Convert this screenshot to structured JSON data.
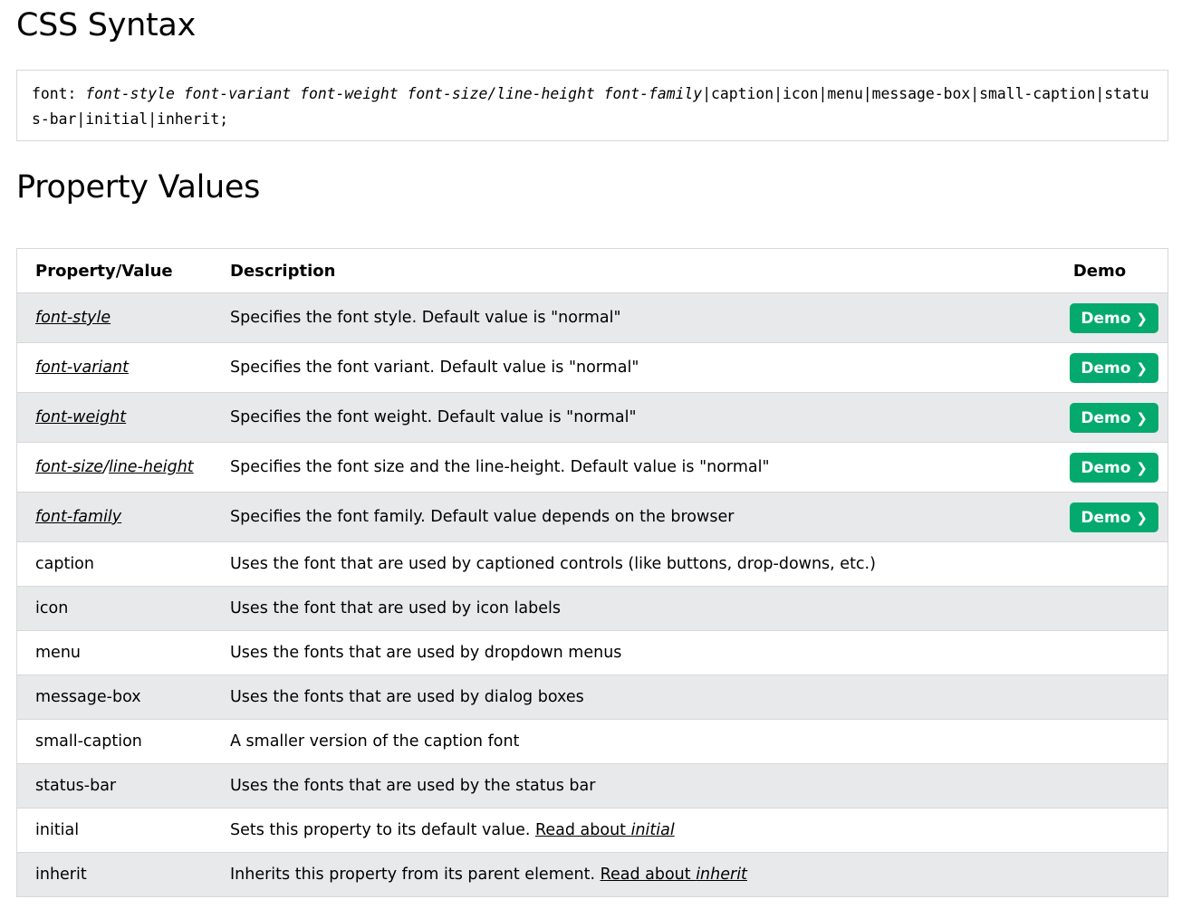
{
  "headings": {
    "syntax": "CSS Syntax",
    "values": "Property Values"
  },
  "syntax": {
    "prefix": "font: ",
    "args": [
      "font-style",
      "font-variant",
      "font-weight",
      "font-size/line-height",
      "font-family"
    ],
    "rest": "|caption|icon|menu|message-box|small-caption|status-bar|initial|inherit;"
  },
  "table": {
    "headers": {
      "property": "Property/Value",
      "description": "Description",
      "demo": "Demo"
    },
    "demo_label": "Demo",
    "demo_chevron": "❯",
    "rows": [
      {
        "value": "font-style",
        "description": "Specifies the font style. Default value is \"normal\""
      },
      {
        "value": "font-variant",
        "description": "Specifies the font variant. Default value is \"normal\""
      },
      {
        "value": "font-weight",
        "description": "Specifies the font weight. Default value is \"normal\""
      },
      {
        "value_a": "font-size",
        "value_sep": "/",
        "value_b": "line-height",
        "description": "Specifies the font size and the line-height. Default value is \"normal\""
      },
      {
        "value": "font-family",
        "description": "Specifies the font family. Default value depends on the browser"
      },
      {
        "value": "caption",
        "description": "Uses the font that are used by captioned controls (like buttons, drop-downs, etc.)"
      },
      {
        "value": "icon",
        "description": "Uses the font that are used by icon labels"
      },
      {
        "value": "menu",
        "description": "Uses the fonts that are used by dropdown menus"
      },
      {
        "value": "message-box",
        "description": "Uses the fonts that are used by dialog boxes"
      },
      {
        "value": "small-caption",
        "description": "A smaller version of the caption font"
      },
      {
        "value": "status-bar",
        "description": "Uses the fonts that are used by the status bar"
      },
      {
        "value": "initial",
        "description": "Sets this property to its default value. ",
        "link_text": "Read about ",
        "link_em": "initial"
      },
      {
        "value": "inherit",
        "description": "Inherits this property from its parent element. ",
        "link_text": "Read about ",
        "link_em": "inherit"
      }
    ]
  },
  "colors": {
    "demo_button": "#04aa6d",
    "stripe": "#e7e9eb",
    "border": "#d8d8d8"
  }
}
